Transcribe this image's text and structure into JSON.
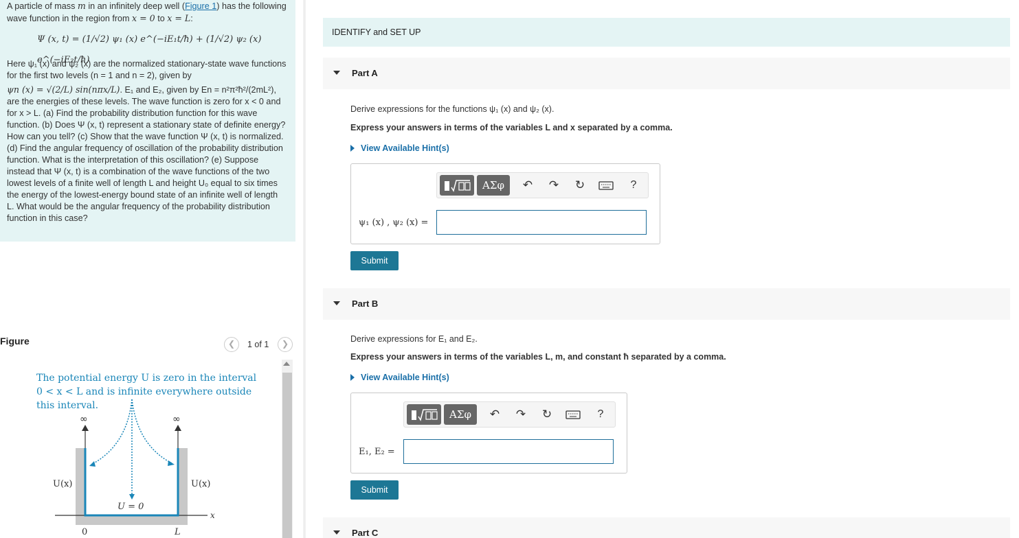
{
  "problem": {
    "intro_a": "A particle of mass ",
    "var_m": "m",
    "intro_b": " in an infinitely deep well (",
    "figure_link": "Figure 1",
    "intro_c": ") has the following wave function in the region from ",
    "range_from": "x = 0",
    "intro_to": " to ",
    "range_to": "x = L",
    "intro_end": ":",
    "wave_equation": "Ψ (x, t) = (1/√2) ψ₁ (x) e^(−iE₁t/ħ) + (1/√2) ψ₂ (x) e^(−iE₂t/ħ)",
    "para1": "Here ψ₁ (x) and ψ₂ (x) are the normalized stationary-state wave functions for the first two levels (n = 1 and n = 2), given by",
    "psi_n": "ψn (x) = √(2/L) sin(nπx/L)",
    "para2": ". E₁ and E₂, given by En = n²π²ħ²/(2mL²), are the energies of these levels. The wave function is zero for x < 0 and for x > L. (a) Find the probability distribution function for this wave function. (b) Does Ψ (x, t) represent a stationary state of definite energy? How can you tell? (c) Show that the wave function Ψ (x, t) is normalized. (d) Find the angular frequency of oscillation of the probability distribution function. What is the interpretation of this oscillation? (e) Suppose instead that Ψ (x, t) is a combination of the wave functions of the two lowest levels of a finite well of length L and height U₀ equal to six times the energy of the lowest-energy bound state of an infinite well of length L. What would be the angular frequency of the probability distribution function in this case?"
  },
  "figure": {
    "title": "Figure",
    "pager": "1 of 1",
    "caption_line1": "The potential energy U is zero in the interval",
    "caption_line2": "0 < x < L and is infinite everywhere outside",
    "caption_line3": "this interval.",
    "infinity": "∞",
    "u_left": "U(x)",
    "u_right": "U(x)",
    "u_zero": "U = 0",
    "axis_x": "x",
    "tick_0": "0",
    "tick_L": "L"
  },
  "identify": "IDENTIFY and SET UP",
  "parts": [
    {
      "label": "Part A",
      "derive": "Derive expressions for the functions ψ₁ (x) and ψ₂ (x).",
      "express": "Express your answers in terms of the variables L and x separated by a comma.",
      "hint": "View Available Hint(s)",
      "answer_label": "ψ₁ (x) , ψ₂ (x) =",
      "answer_value": "",
      "submit": "Submit"
    },
    {
      "label": "Part B",
      "derive": "Derive expressions for E₁ and E₂.",
      "express": "Express your answers in terms of the variables L, m, and constant ħ separated by a comma.",
      "hint": "View Available Hint(s)",
      "answer_label": "E₁, E₂ =",
      "answer_value": "",
      "submit": "Submit"
    },
    {
      "label": "Part C"
    }
  ],
  "toolbar": {
    "greek": "ΑΣφ",
    "help": "?"
  },
  "colors": {
    "panel_bg": "#e4f4f4",
    "link": "#1a6fa8",
    "submit_bg": "#1d7795",
    "figure_blue": "#1a86b8"
  }
}
